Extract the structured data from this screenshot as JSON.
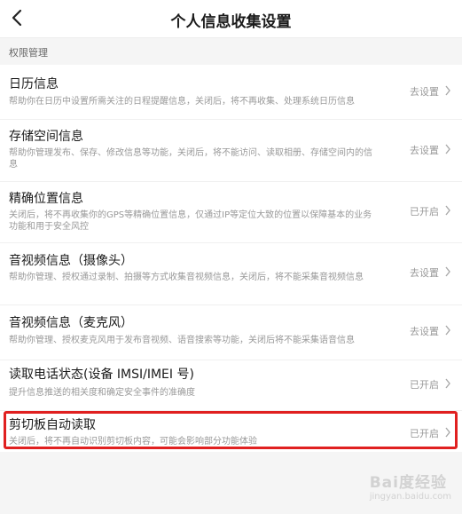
{
  "header": {
    "title": "个人信息收集设置"
  },
  "section": {
    "label": "权限管理"
  },
  "items": [
    {
      "title": "日历信息",
      "desc": "帮助你在日历中设置所需关注的日程提醒信息，关闭后，将不再收集、处理系统日历信息",
      "status": "去设置"
    },
    {
      "title": "存储空间信息",
      "desc": "帮助你管理发布、保存、修改信息等功能，关闭后，将不能访问、读取相册、存储空间内的信息",
      "status": "去设置"
    },
    {
      "title": "精确位置信息",
      "desc": "关闭后，将不再收集你的GPS等精确位置信息，仅通过IP等定位大致的位置以保障基本的业务功能和用于安全风控",
      "status": "已开启"
    },
    {
      "title": "音视频信息（摄像头）",
      "desc": "帮助你管理、授权通过录制、拍摄等方式收集音视频信息，关闭后，将不能采集音视频信息",
      "status": "去设置"
    },
    {
      "title": "音视频信息（麦克风）",
      "desc": "帮助你管理、授权麦克风用于发布音视频、语音搜索等功能，关闭后将不能采集语音信息",
      "status": "去设置"
    },
    {
      "title": "读取电话状态(设备 IMSI/IMEI 号)",
      "desc": "提升信息推送的相关度和确定安全事件的准确度",
      "status": "已开启"
    },
    {
      "title": "剪切板自动读取",
      "desc": "关闭后，将不再自动识别剪切板内容，可能会影响部分功能体验",
      "status": "已开启"
    }
  ],
  "watermark": {
    "text": "Bai度经验",
    "sub": "jingyan.baidu.com"
  },
  "colors": {
    "highlight": "#e02020",
    "background": "#f5f5f5",
    "card": "#ffffff"
  }
}
